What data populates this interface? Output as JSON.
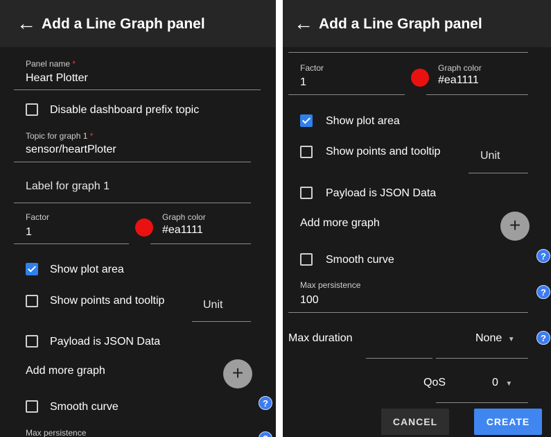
{
  "header": {
    "title": "Add a Line Graph panel"
  },
  "left": {
    "panel_name": {
      "label": "Panel name",
      "required_mark": "*",
      "value": "Heart Plotter"
    },
    "disable_prefix": {
      "label": "Disable dashboard prefix topic",
      "checked": false
    },
    "topic": {
      "label": "Topic for graph 1",
      "required_mark": "*",
      "value": "sensor/heartPloter"
    },
    "graph_label": {
      "placeholder": "Label for graph 1"
    },
    "factor": {
      "label": "Factor",
      "value": "1"
    },
    "graph_color": {
      "label": "Graph color",
      "value": "#ea1111"
    },
    "show_plot_area": {
      "label": "Show plot area",
      "checked": true
    },
    "show_points": {
      "label": "Show points and tooltip",
      "checked": false
    },
    "unit": {
      "placeholder": "Unit"
    },
    "payload_json": {
      "label": "Payload is JSON Data",
      "checked": false
    },
    "add_more": {
      "label": "Add more graph",
      "icon": "plus-icon"
    },
    "smooth_curve": {
      "label": "Smooth curve",
      "checked": false
    },
    "max_persistence": {
      "label": "Max persistence"
    }
  },
  "right": {
    "factor": {
      "label": "Factor",
      "value": "1"
    },
    "graph_color": {
      "label": "Graph color",
      "value": "#ea1111"
    },
    "show_plot_area": {
      "label": "Show plot area",
      "checked": true
    },
    "show_points": {
      "label": "Show points and tooltip",
      "checked": false
    },
    "unit": {
      "placeholder": "Unit"
    },
    "payload_json": {
      "label": "Payload is JSON Data",
      "checked": false
    },
    "add_more": {
      "label": "Add more graph",
      "icon": "plus-icon"
    },
    "smooth_curve": {
      "label": "Smooth curve",
      "checked": false
    },
    "max_persistence": {
      "label": "Max persistence",
      "value": "100"
    },
    "max_duration": {
      "label": "Max duration",
      "value": "None"
    },
    "qos": {
      "label": "QoS",
      "value": "0"
    },
    "cancel_label": "CANCEL",
    "create_label": "CREATE"
  },
  "icons": {
    "back": "←",
    "plus": "+",
    "help": "?",
    "caret": "▼"
  },
  "colors": {
    "accent": "#3f86f0",
    "graph_color": "#ea1111",
    "background": "#1a1a1a",
    "appbar": "#262626"
  }
}
